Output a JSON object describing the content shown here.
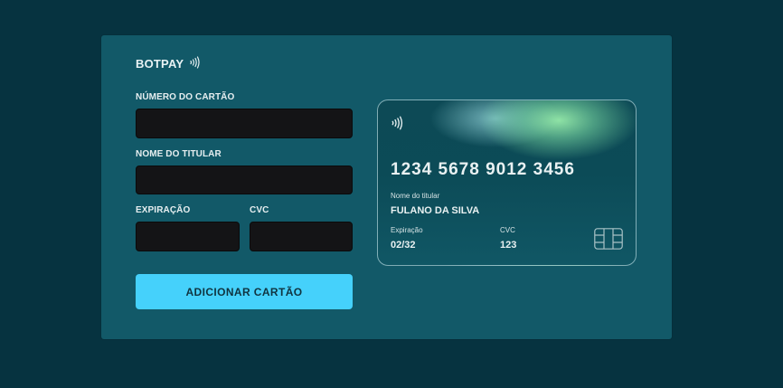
{
  "brand": {
    "name": "BOTPAY",
    "icon": "contactless-icon"
  },
  "form": {
    "card_number_label": "NÚMERO DO CARTÃO",
    "card_number_value": "",
    "holder_name_label": "NOME DO TITULAR",
    "holder_name_value": "",
    "expiration_label": "EXPIRAÇÃO",
    "expiration_value": "",
    "cvc_label": "CVC",
    "cvc_value": "",
    "submit_label": "ADICIONAR CARTÃO"
  },
  "card": {
    "number": "1234 5678 9012 3456",
    "holder_label": "Nome do titular",
    "holder_value": "FULANO DA SILVA",
    "expiration_label": "Expiração",
    "expiration_value": "02/32",
    "cvc_label": "CVC",
    "cvc_value": "123",
    "icons": [
      "contactless-icon",
      "chip-icon"
    ]
  },
  "colors": {
    "page_bg": "#063340",
    "panel_bg": "#125968",
    "input_bg": "#141416",
    "button_bg": "#45d1fb"
  }
}
